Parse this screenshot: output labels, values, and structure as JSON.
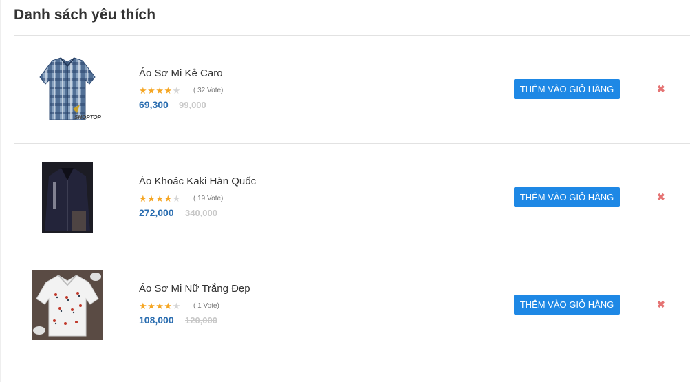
{
  "page": {
    "title": "Danh sách yêu thích"
  },
  "wishlist": [
    {
      "name": "Áo Sơ Mi Kẻ Caro",
      "rating": 4,
      "rating_max": 5,
      "votes": "( 32 Vote)",
      "price": "69,300",
      "old_price": "99,000",
      "button": "THÊM VÀO GIỎ HÀNG",
      "remove": "✖",
      "image_watermark": "SHOPTOP"
    },
    {
      "name": "Áo Khoác Kaki Hàn Quốc",
      "rating": 4,
      "rating_max": 5,
      "votes": "( 19 Vote)",
      "price": "272,000",
      "old_price": "340,000",
      "button": "THÊM VÀO GIỎ HÀNG",
      "remove": "✖"
    },
    {
      "name": "Áo Sơ Mi Nữ Trắng Đẹp",
      "rating": 4,
      "rating_max": 5,
      "votes": "( 1 Vote)",
      "price": "108,000",
      "old_price": "120,000",
      "button": "THÊM VÀO GIỎ HÀNG",
      "remove": "✖"
    }
  ],
  "colors": {
    "accent": "#1e88e5",
    "price": "#2a6db0",
    "star": "#f5a623",
    "remove": "#e57373"
  }
}
